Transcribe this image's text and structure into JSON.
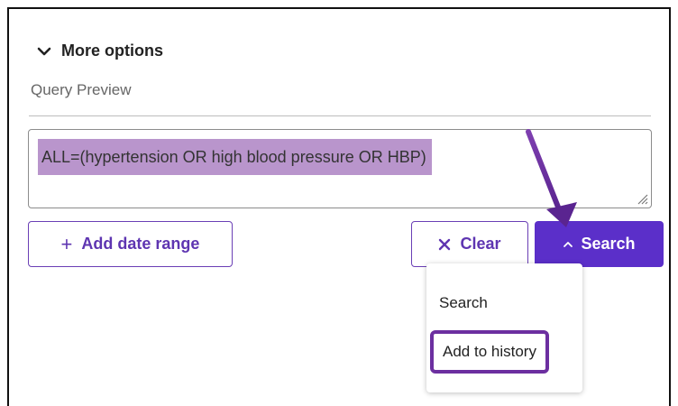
{
  "section": {
    "toggle_label": "More options",
    "query_preview_label": "Query Preview"
  },
  "query": {
    "text": "ALL=(hypertension OR high blood pressure OR HBP)"
  },
  "buttons": {
    "add_date_range": "Add date range",
    "clear": "Clear",
    "search": "Search"
  },
  "dropdown": {
    "items": [
      "Search",
      "Add to history"
    ]
  },
  "colors": {
    "accent": "#5b2fc9",
    "highlight": "#b995cc",
    "annotation": "#6c2fa0"
  },
  "icons": {
    "toggle": "chevron-down-icon",
    "add": "plus-icon",
    "clear": "close-icon",
    "search": "chevron-up-icon"
  }
}
